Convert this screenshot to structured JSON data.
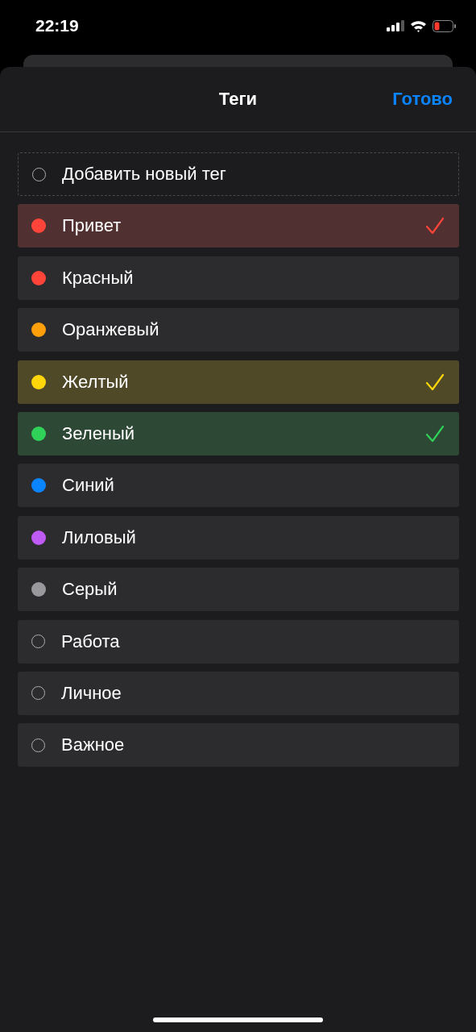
{
  "status_bar": {
    "time": "22:19"
  },
  "header": {
    "title": "Теги",
    "done_button": "Готово"
  },
  "tags": [
    {
      "kind": "add",
      "label": "Добавить новый тег",
      "selected": false
    },
    {
      "kind": "dot",
      "label": "Привет",
      "color": "#ff453a",
      "selected": true
    },
    {
      "kind": "dot",
      "label": "Красный",
      "color": "#ff453a",
      "selected": false
    },
    {
      "kind": "dot",
      "label": "Оранжевый",
      "color": "#ff9f0a",
      "selected": false
    },
    {
      "kind": "dot",
      "label": "Желтый",
      "color": "#ffd60a",
      "selected": true
    },
    {
      "kind": "dot",
      "label": "Зеленый",
      "color": "#30d158",
      "selected": true
    },
    {
      "kind": "dot",
      "label": "Синий",
      "color": "#0a84ff",
      "selected": false
    },
    {
      "kind": "dot",
      "label": "Лиловый",
      "color": "#bf5af2",
      "selected": false
    },
    {
      "kind": "dot",
      "label": "Серый",
      "color": "#98989d",
      "selected": false
    },
    {
      "kind": "hollow",
      "label": "Работа",
      "selected": false
    },
    {
      "kind": "hollow",
      "label": "Личное",
      "selected": false
    },
    {
      "kind": "hollow",
      "label": "Важное",
      "selected": false
    }
  ]
}
